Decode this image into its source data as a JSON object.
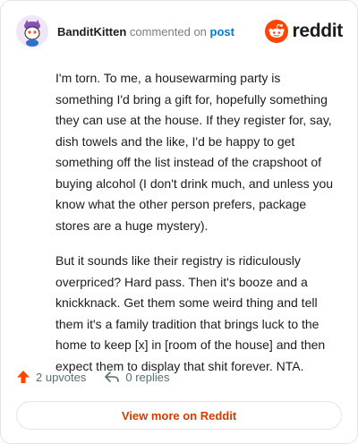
{
  "header": {
    "username": "BanditKitten",
    "commented_text": "commented on",
    "post_link": "post",
    "brand": "reddit"
  },
  "comment": {
    "paragraphs": [
      "I'm torn. To me, a housewarming party is something I'd bring a gift for, hopefully something they can use at the house. If they register for, say, dish towels and the like, I'd be happy to get something off the list instead of the crapshoot of buying alcohol (I don't drink much, and unless you know what the other person prefers, package stores are a huge mystery).",
      "But it sounds like their registry is ridiculously overpriced? Hard pass. Then it's booze and a knickknack. Get them some weird thing and tell them it's a family tradition that brings luck to the home to keep [x] in [room of the house] and then expect them to display that shit forever. NTA."
    ]
  },
  "actions": {
    "upvotes": "2 upvotes",
    "replies": "0 replies"
  },
  "footer": {
    "view_more": "View more on Reddit"
  },
  "colors": {
    "brand": "#ff4500",
    "link": "#0079d3",
    "view_more": "#d93a00",
    "muted": "#576f76"
  },
  "icons": {
    "avatar": "snoo-avatar",
    "brand": "reddit-logo-icon",
    "upvote": "upvote-arrow-icon",
    "reply": "reply-arrow-icon"
  }
}
